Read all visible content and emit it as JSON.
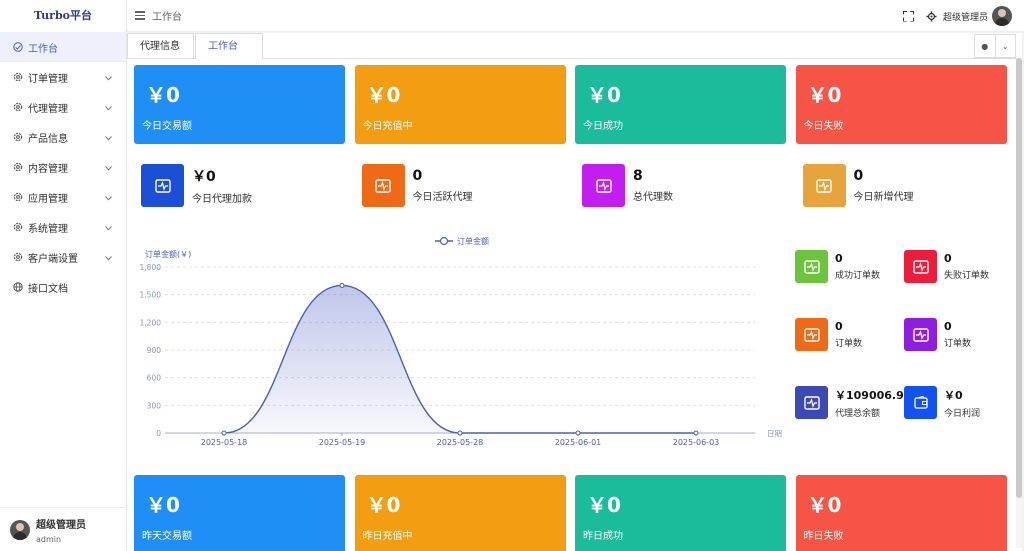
{
  "app": {
    "logo": "Turbo平台"
  },
  "sidebar": {
    "items": [
      {
        "label": "工作台",
        "icon": "dashboard-icon",
        "active": true,
        "expandable": false
      },
      {
        "label": "订单管理",
        "icon": "gear-icon",
        "expandable": true
      },
      {
        "label": "代理管理",
        "icon": "gear-icon",
        "expandable": true
      },
      {
        "label": "产品信息",
        "icon": "gear-icon",
        "expandable": true
      },
      {
        "label": "内容管理",
        "icon": "gear-icon",
        "expandable": true
      },
      {
        "label": "应用管理",
        "icon": "gear-icon",
        "expandable": true
      },
      {
        "label": "系统管理",
        "icon": "gear-icon",
        "expandable": true
      },
      {
        "label": "客户端设置",
        "icon": "gear-icon",
        "expandable": true
      },
      {
        "label": "接口文档",
        "icon": "globe-icon",
        "expandable": false
      }
    ],
    "user": {
      "name": "超级管理员",
      "role": "admin"
    }
  },
  "header": {
    "breadcrumb": "工作台",
    "user_name": "超级管理员"
  },
  "tabs": [
    {
      "label": "代理信息"
    },
    {
      "label": "工作台",
      "active": true,
      "close": "×"
    }
  ],
  "top_cards": [
    {
      "value": "￥0",
      "label": "今日交易额",
      "color": "#1f8ff5"
    },
    {
      "value": "￥0",
      "label": "今日充值中",
      "color": "#f39e12"
    },
    {
      "value": "￥0",
      "label": "今日成功",
      "color": "#1abc9c"
    },
    {
      "value": "￥0",
      "label": "今日失败",
      "color": "#f55446"
    }
  ],
  "mini_stats": [
    {
      "value": "￥0",
      "label": "今日代理加款",
      "color": "#1a4fd6"
    },
    {
      "value": "0",
      "label": "今日活跃代理",
      "color": "#ef6a16"
    },
    {
      "value": "8",
      "label": "总代理数",
      "color": "#c21ef0"
    },
    {
      "value": "0",
      "label": "今日新增代理",
      "color": "#e7a43b"
    }
  ],
  "side_stats": [
    {
      "value": "0",
      "label": "成功订单数",
      "color": "#6cc43a"
    },
    {
      "value": "0",
      "label": "失败订单数",
      "color": "#ef1b3c"
    },
    {
      "value": "0",
      "label": "订单数",
      "color": "#ef6a16"
    },
    {
      "value": "0",
      "label": "订单数",
      "color": "#8d1ee0"
    },
    {
      "value": "￥109006.98",
      "label": "代理总余额",
      "color": "#3d4ab5"
    },
    {
      "value": "￥0",
      "label": "今日利润",
      "color": "#1252f0"
    }
  ],
  "bottom_cards": [
    {
      "value": "￥0",
      "label": "昨天交易额",
      "color": "#1f8ff5"
    },
    {
      "value": "￥0",
      "label": "昨日充值中",
      "color": "#f39e12"
    },
    {
      "value": "￥0",
      "label": "昨日成功",
      "color": "#1abc9c"
    },
    {
      "value": "￥0",
      "label": "昨日失败",
      "color": "#f55446"
    }
  ],
  "chart_data": {
    "type": "line",
    "smooth": true,
    "area_fill": true,
    "categories": [
      "2025-05-18",
      "2025-05-19",
      "2025-05-28",
      "2025-06-01",
      "2025-06-03"
    ],
    "series": [
      {
        "name": "订单金额",
        "values": [
          0,
          1600,
          0,
          0,
          0
        ]
      }
    ],
    "ylabel": "订单金额(￥)",
    "xlabel": "日期",
    "ylim": [
      0,
      1800
    ],
    "yticks": [
      0,
      300,
      600,
      900,
      1200,
      1500,
      1800
    ],
    "ytick_labels": [
      "0",
      "300",
      "600",
      "900",
      "1,200",
      "1,500",
      "1,800"
    ],
    "legend_position": "top-center",
    "grid": true,
    "line_color": "#4b5dbf"
  }
}
